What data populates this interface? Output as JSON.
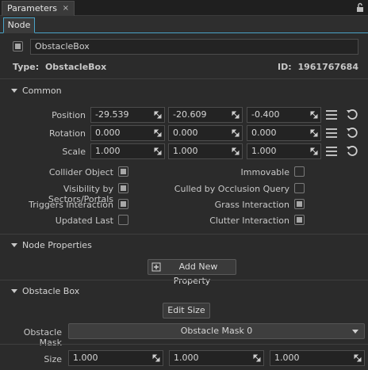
{
  "titlebar": {
    "tab_label": "Parameters",
    "close_glyph": "×",
    "lock_icon": "lock-icon"
  },
  "subtabs": {
    "node_label": "Node"
  },
  "node": {
    "enabled": true,
    "name": "ObstacleBox",
    "type_label": "Type:",
    "type_value": "ObstacleBox",
    "id_label": "ID:",
    "id_value": "1961767684"
  },
  "common": {
    "title": "Common",
    "position": {
      "label": "Position",
      "x": "-29.539",
      "y": "-20.609",
      "z": "-0.400"
    },
    "rotation": {
      "label": "Rotation",
      "x": "0.000",
      "y": "0.000",
      "z": "0.000"
    },
    "scale": {
      "label": "Scale",
      "x": "1.000",
      "y": "1.000",
      "z": "1.000"
    },
    "flags": {
      "collider_object": {
        "label": "Collider Object",
        "checked": true
      },
      "immovable": {
        "label": "Immovable",
        "checked": false
      },
      "visibility_sectors": {
        "label": "Visibility by Sectors/Portals",
        "checked": true
      },
      "culled_occlusion": {
        "label": "Culled by Occlusion Query",
        "checked": false
      },
      "triggers_interaction": {
        "label": "Triggers Interaction",
        "checked": true
      },
      "grass_interaction": {
        "label": "Grass Interaction",
        "checked": true
      },
      "updated_last": {
        "label": "Updated Last",
        "checked": false
      },
      "clutter_interaction": {
        "label": "Clutter Interaction",
        "checked": true
      }
    }
  },
  "node_properties": {
    "title": "Node Properties",
    "add_button": "Add New Property"
  },
  "obstacle_box": {
    "title": "Obstacle Box",
    "edit_size_button": "Edit Size",
    "mask_label": "Obstacle Mask",
    "mask_value": "Obstacle Mask 0",
    "size": {
      "label": "Size",
      "x": "1.000",
      "y": "1.000",
      "z": "1.000"
    }
  }
}
